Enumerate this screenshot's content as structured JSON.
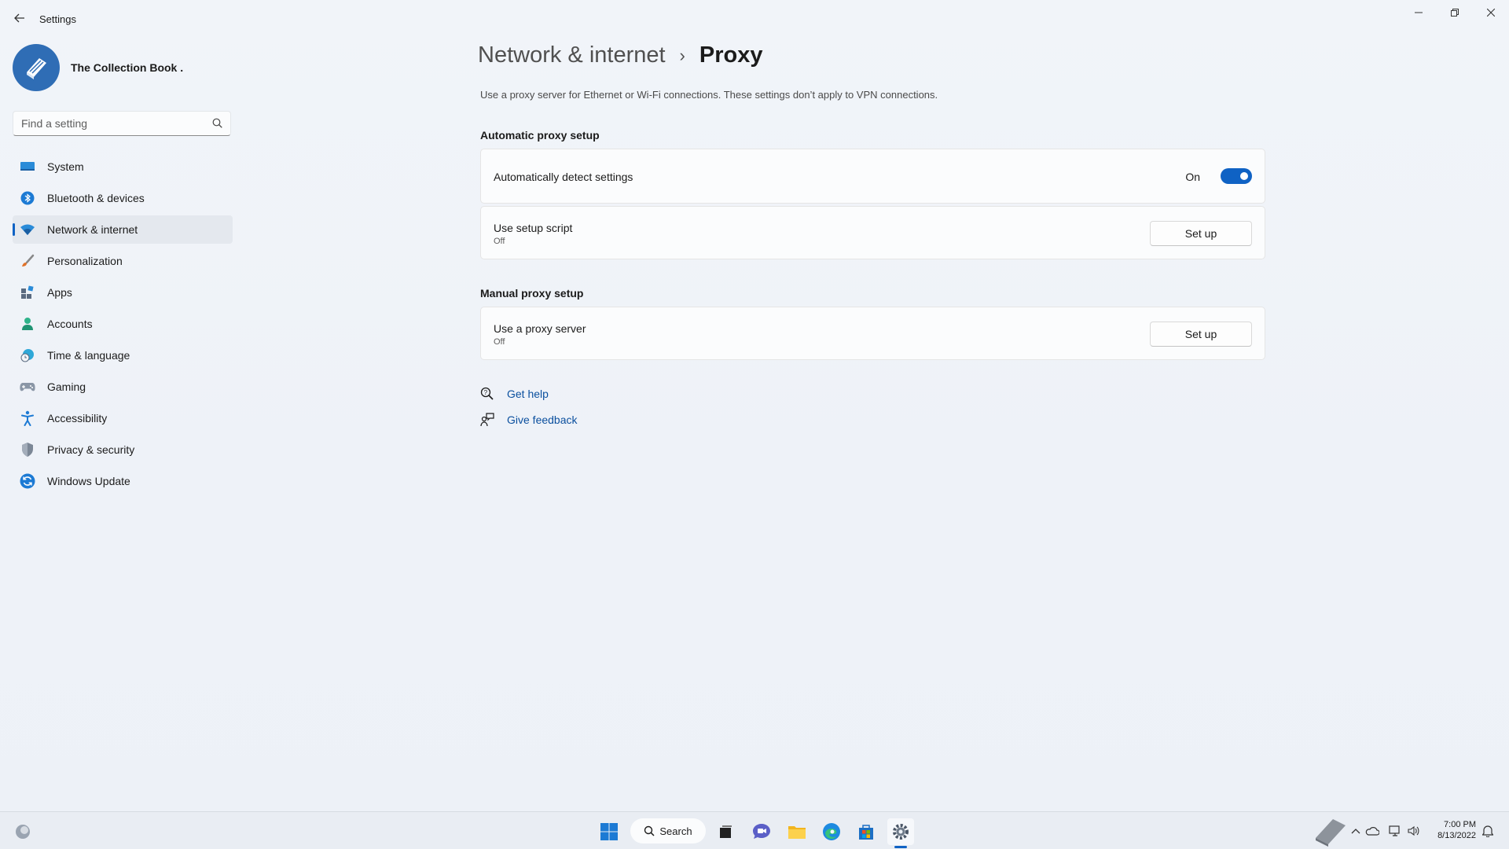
{
  "window": {
    "title": "Settings",
    "controls": {
      "minimize": "minimize-icon",
      "maximize": "restore-icon",
      "close": "close-icon"
    }
  },
  "profile": {
    "name": "The Collection Book ."
  },
  "search": {
    "placeholder": "Find a setting"
  },
  "sidebar": {
    "items": [
      {
        "label": "System",
        "icon": "system-icon"
      },
      {
        "label": "Bluetooth & devices",
        "icon": "bluetooth-icon"
      },
      {
        "label": "Network & internet",
        "icon": "wifi-icon",
        "selected": true
      },
      {
        "label": "Personalization",
        "icon": "brush-icon"
      },
      {
        "label": "Apps",
        "icon": "apps-icon"
      },
      {
        "label": "Accounts",
        "icon": "person-icon"
      },
      {
        "label": "Time & language",
        "icon": "globe-clock-icon"
      },
      {
        "label": "Gaming",
        "icon": "gamepad-icon"
      },
      {
        "label": "Accessibility",
        "icon": "accessibility-icon"
      },
      {
        "label": "Privacy & security",
        "icon": "shield-icon"
      },
      {
        "label": "Windows Update",
        "icon": "update-icon"
      }
    ]
  },
  "header": {
    "parent": "Network & internet",
    "separator": "›",
    "current": "Proxy",
    "description": "Use a proxy server for Ethernet or Wi-Fi connections. These settings don’t apply to VPN connections."
  },
  "automatic": {
    "section_title": "Automatic proxy setup",
    "detect": {
      "title": "Automatically detect settings",
      "state_label": "On",
      "enabled": true
    },
    "script": {
      "title": "Use setup script",
      "status": "Off",
      "button": "Set up"
    }
  },
  "manual": {
    "section_title": "Manual proxy setup",
    "proxy_server": {
      "title": "Use a proxy server",
      "status": "Off",
      "button": "Set up"
    }
  },
  "help": {
    "get_help": "Get help",
    "give_feedback": "Give feedback"
  },
  "taskbar": {
    "search_label": "Search",
    "clock_time": "7:00 PM",
    "clock_date": "8/13/2022"
  },
  "colors": {
    "accent": "#0f62c4",
    "link": "#0a4f9e",
    "background": "#eef2f8",
    "card": "#fbfcfd"
  }
}
